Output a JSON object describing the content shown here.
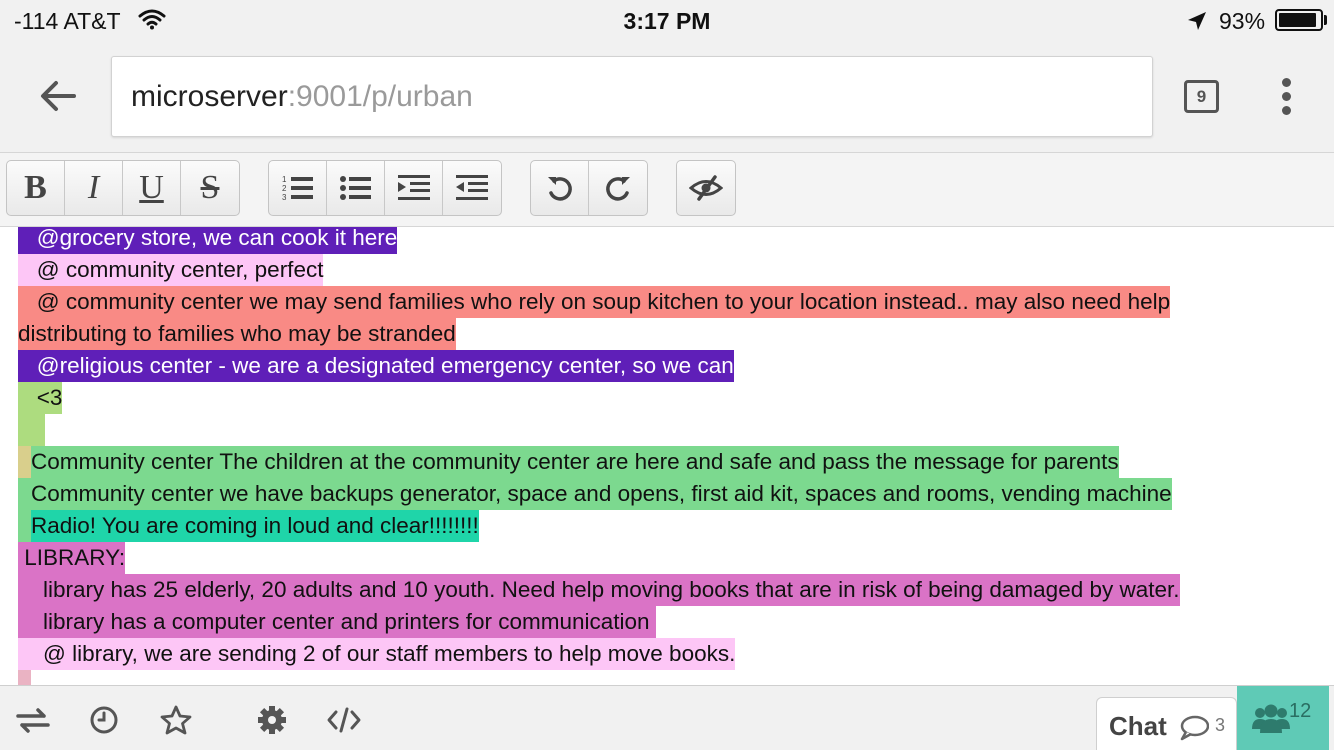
{
  "status_bar": {
    "carrier": "-114 AT&T",
    "time": "3:17 PM",
    "battery_percent": "93%",
    "battery_level": 0.93,
    "icons": [
      "wifi-icon",
      "location-arrow-icon",
      "battery-icon"
    ]
  },
  "browser": {
    "url_host": "microserver",
    "url_path": ":9001/p/urban",
    "tab_count": "9",
    "icons": [
      "back-arrow-icon",
      "tabs-icon",
      "more-menu-icon"
    ]
  },
  "toolbar": {
    "buttons": [
      "B",
      "I",
      "U",
      "S",
      "ordered-list-icon",
      "unordered-list-icon",
      "indent-icon",
      "outdent-icon",
      "undo-icon",
      "redo-icon",
      "hide-authorship-colors-icon"
    ]
  },
  "colors": {
    "purple": "#5f1fb8",
    "pink": "#fdc6f6",
    "salmon": "#f98a85",
    "light_green": "#addc7f",
    "green": "#7cd98f",
    "teal": "#1fd5a9",
    "magenta": "#da73c6",
    "tan": "#d9cf8c",
    "rose": "#eab3c3",
    "users_accent": "#5fcab6"
  },
  "document": {
    "lines": [
      "   @grocery store, we can cook it here",
      "   @ community center, perfect",
      "   @ community center we may send families who rely on soup kitchen to your location instead.. may also need help",
      "distributing to families who may be stranded",
      "   @religious center - we are a designated emergency center, so we can",
      "   <3",
      "Community center The children at the community center are here and safe and pass the message for parents",
      "Community center we have backups generator, space and opens, first aid kit, spaces and rooms, vending machine",
      "Radio! You are coming in loud and clear!!!!!!!!",
      " LIBRARY:",
      "    library has 25 elderly, 20 adults and 10 youth. Need help moving books that are in risk of being damaged by water.",
      "    library has a computer center and printers for communication ",
      "    @ library, we are sending 2 of our staff members to help move books."
    ]
  },
  "bottom_bar": {
    "icons": [
      "import-export-icon",
      "timeslider-icon",
      "star-icon",
      "settings-icon",
      "embed-icon"
    ],
    "chat_label": "Chat",
    "chat_count": "3",
    "users_count": "12"
  }
}
